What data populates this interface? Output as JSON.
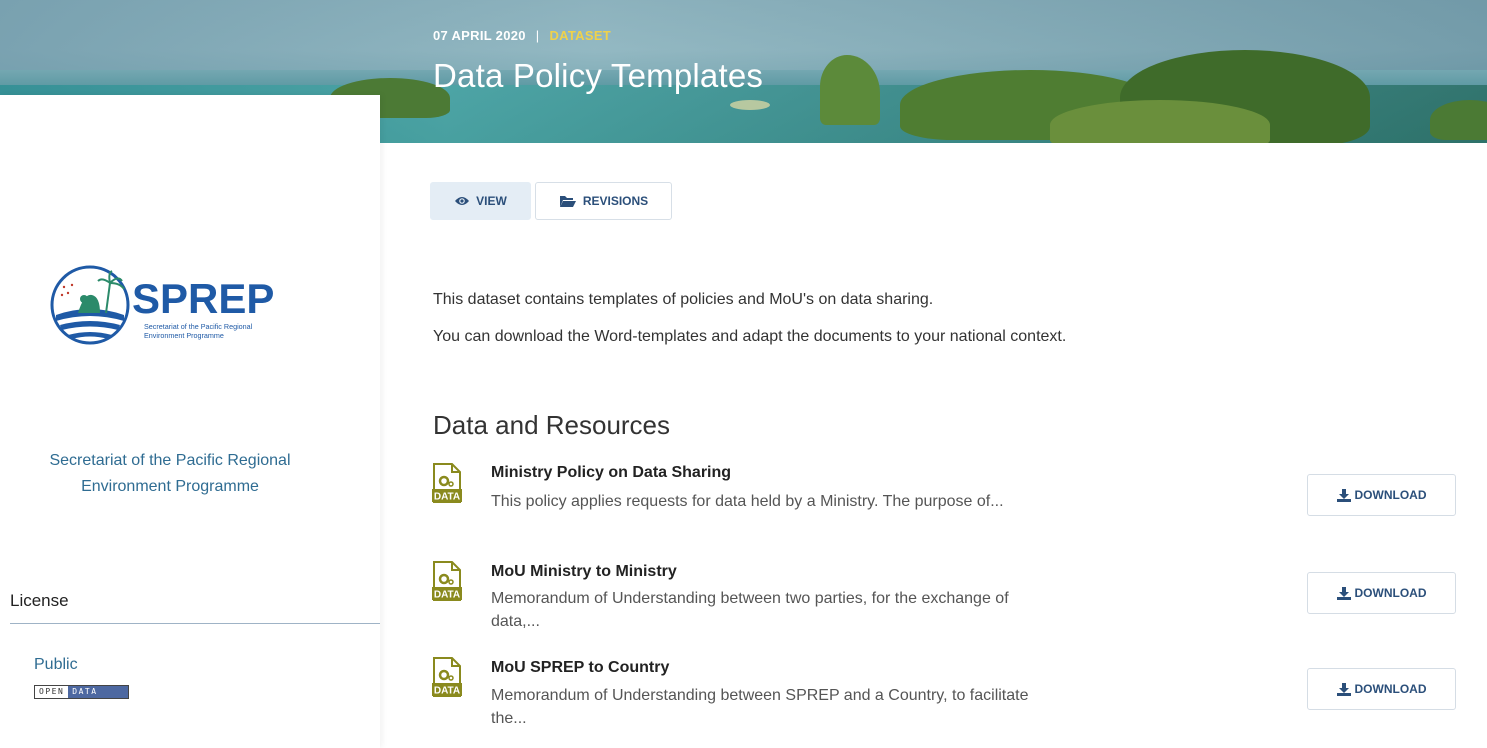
{
  "banner": {
    "date": "07 APRIL 2020",
    "separator": "|",
    "type": "DATASET",
    "title": "Data Policy Templates"
  },
  "sidebar": {
    "logo_text": "SPREP",
    "logo_subtitle_line1": "Secretariat of the Pacific Regional",
    "logo_subtitle_line2": "Environment Programme",
    "org_name_line1": "Secretariat of the Pacific Regional",
    "org_name_line2": "Environment Programme",
    "license_heading": "License",
    "license_value": "Public",
    "badge_left": "OPEN",
    "badge_right": "DATA"
  },
  "tabs": [
    {
      "label": "VIEW",
      "icon": "eye-icon",
      "active": true
    },
    {
      "label": "REVISIONS",
      "icon": "folder-open-icon",
      "active": false
    }
  ],
  "description": {
    "line1": "This dataset contains templates of policies and MoU's on data sharing.",
    "line2": "You can download the Word-templates and adapt the documents to your national context."
  },
  "resources_heading": "Data and Resources",
  "resources": [
    {
      "title": "Ministry Policy on Data Sharing",
      "desc_line1": "This policy applies requests for data held by a Ministry. The purpose of...",
      "desc_line2": "",
      "icon_text": "DATA",
      "button": "DOWNLOAD"
    },
    {
      "title": "MoU Ministry to Ministry",
      "desc_line1": "Memorandum of Understanding between two parties, for the exchange of",
      "desc_line2": "data,...",
      "icon_text": "DATA",
      "button": "DOWNLOAD"
    },
    {
      "title": "MoU SPREP to Country",
      "desc_line1": "Memorandum of Understanding between SPREP and a Country, to facilitate",
      "desc_line2": "the...",
      "icon_text": "DATA",
      "button": "DOWNLOAD"
    }
  ],
  "colors": {
    "accent_yellow": "#f0d24a",
    "link_blue": "#2f6c92",
    "button_text": "#2b4f7a",
    "data_icon": "#8a8a1e"
  }
}
